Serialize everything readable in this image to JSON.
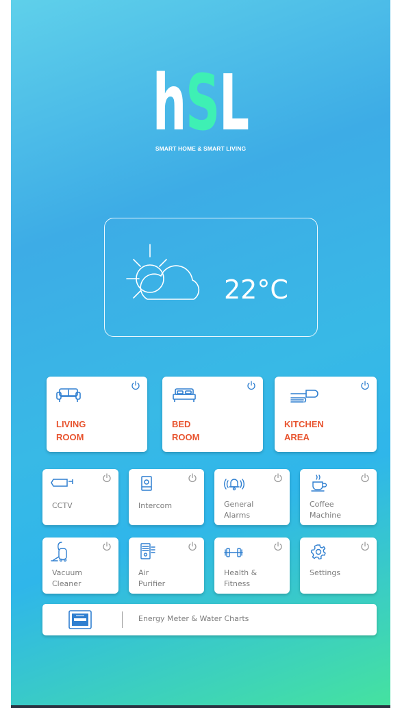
{
  "brand": {
    "logo_text_h": "h",
    "logo_text_s": "S",
    "logo_text_l": "L",
    "tagline": "SMART HOME & SMART LIVING"
  },
  "weather": {
    "temperature": "22°C",
    "icon": "partly-cloudy-icon"
  },
  "rooms": [
    {
      "line1": "LIVING",
      "line2": "ROOM",
      "icon": "sofa-icon"
    },
    {
      "line1": "BED",
      "line2": "ROOM",
      "icon": "bed-icon"
    },
    {
      "line1": "KITCHEN",
      "line2": "AREA",
      "icon": "kitchen-icon"
    }
  ],
  "devices": [
    {
      "line1": "CCTV",
      "line2": "",
      "icon": "cctv-camera-icon"
    },
    {
      "line1": "Intercom",
      "line2": "",
      "icon": "intercom-icon"
    },
    {
      "line1": "General",
      "line2": "Alarms",
      "icon": "alarm-bell-icon"
    },
    {
      "line1": "Coffee",
      "line2": "Machine",
      "icon": "coffee-cup-icon"
    },
    {
      "line1": "Vacuum",
      "line2": "Cleaner",
      "icon": "vacuum-icon"
    },
    {
      "line1": "Air",
      "line2": "Purifier",
      "icon": "air-purifier-icon"
    },
    {
      "line1": "Health &",
      "line2": "Fitness",
      "icon": "dumbbell-icon"
    },
    {
      "line1": "Settings",
      "line2": "",
      "icon": "gear-icon"
    }
  ],
  "energy": {
    "label": "Energy Meter & Water Charts",
    "icon": "energy-meter-icon"
  },
  "colors": {
    "accent": "#e8542f",
    "logo_green": "#3ef0b4",
    "icon_blue": "#2f7fd0"
  }
}
